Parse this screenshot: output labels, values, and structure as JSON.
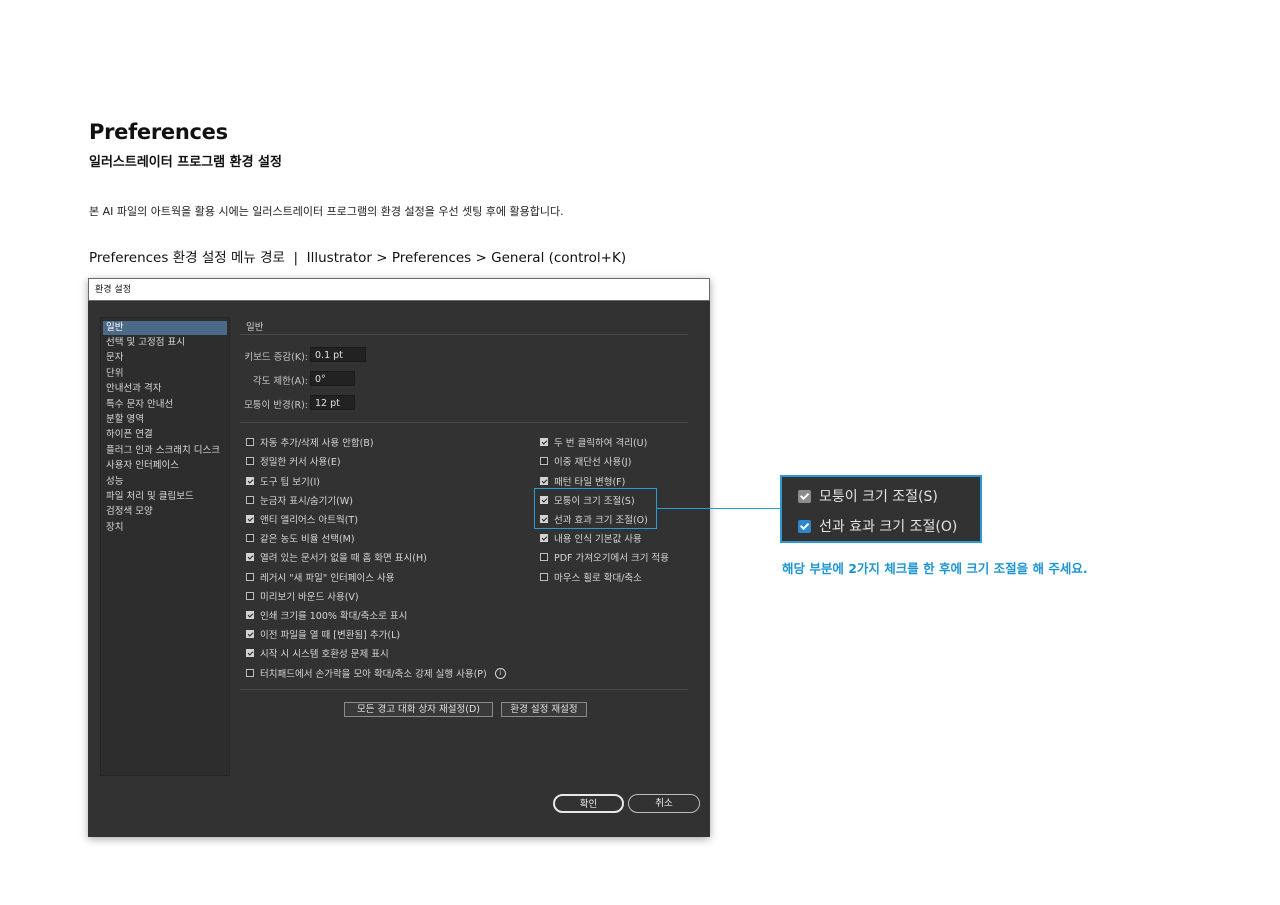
{
  "header": {
    "title": "Preferences",
    "subtitle": "일러스트레이터 프로그램 환경 설정",
    "description": "본 AI 파일의 아트웍을 활용 시에는 일러스트레이터 프로그램의 환경 설정을 우선 셋팅 후에 활용합니다.",
    "menu_path": "Preferences 환경 설정 메뉴 경로  |  Illustrator > Preferences > General (control+K)"
  },
  "dialog": {
    "title": "환경 설정",
    "sidebar": [
      {
        "label": "일반",
        "selected": true
      },
      {
        "label": "선택 및 고정점 표시"
      },
      {
        "label": "문자"
      },
      {
        "label": "단위"
      },
      {
        "label": "안내선과 격자"
      },
      {
        "label": "특수 문자 안내선"
      },
      {
        "label": "분할 영역"
      },
      {
        "label": "하이픈 연결"
      },
      {
        "label": "플러그 인과 스크래치 디스크"
      },
      {
        "label": "사용자 인터페이스"
      },
      {
        "label": "성능"
      },
      {
        "label": "파일 처리 및 클립보드"
      },
      {
        "label": "검정색 모양"
      },
      {
        "label": "장치"
      }
    ],
    "section_title": "일반",
    "fields": [
      {
        "label": "키보드 증감(K):",
        "value": "0.1 pt"
      },
      {
        "label": "각도 제한(A):",
        "value": "0°"
      },
      {
        "label": "모퉁이 반경(R):",
        "value": "12 pt"
      }
    ],
    "left_options": [
      {
        "label": "자동 추가/삭제 사용 안함(B)",
        "checked": false
      },
      {
        "label": "정밀한 커서 사용(E)",
        "checked": false
      },
      {
        "label": "도구 팁 보기(I)",
        "checked": true
      },
      {
        "label": "눈금자 표시/숨기기(W)",
        "checked": false
      },
      {
        "label": "앤티 앨리어스 아트웍(T)",
        "checked": true
      },
      {
        "label": "같은 농도 비율 선택(M)",
        "checked": false
      },
      {
        "label": "열려 있는 문서가 없을 때 홈 화면 표시(H)",
        "checked": true
      },
      {
        "label": "레거시 \"새 파일\" 인터페이스 사용",
        "checked": false
      },
      {
        "label": "미리보기 바운드 사용(V)",
        "checked": false
      },
      {
        "label": "인쇄 크기를 100% 확대/축소로 표시",
        "checked": true
      },
      {
        "label": "이전 파일을 열 때 [변환됨] 추가(L)",
        "checked": true
      },
      {
        "label": "시작 시 시스템 호환성 문제 표시",
        "checked": true
      },
      {
        "label": "터치패드에서 손가락을 모아 확대/축소 강제 실행 사용(P)",
        "checked": false
      }
    ],
    "right_options": [
      {
        "label": "두 번 클릭하여 격리(U)",
        "checked": true
      },
      {
        "label": "이중 재단선 사용(J)",
        "checked": false
      },
      {
        "label": "패턴 타일 변형(F)",
        "checked": true
      },
      {
        "label": "모퉁이 크기 조절(S)",
        "checked": true
      },
      {
        "label": "선과 효과 크기 조절(O)",
        "checked": true
      },
      {
        "label": "내용 인식 기본값 사용",
        "checked": true
      },
      {
        "label": "PDF 가져오기에서 크기 적용",
        "checked": false
      },
      {
        "label": "마우스 휠로 확대/축소",
        "checked": false
      }
    ],
    "info_icon": "info-icon",
    "reset_warnings_label": "모든 경고 대화 상자 재설정(D)",
    "reset_prefs_label": "환경 설정 재설정",
    "ok_label": "확인",
    "cancel_label": "취소"
  },
  "callout": {
    "options": [
      {
        "label": "모퉁이 크기 조절(S)",
        "checked": true
      },
      {
        "label": "선과 효과 크기 조절(O)",
        "checked": true
      }
    ],
    "note": "해당 부분에 2가지 체크를 한 후에 크기 조절을 해 주세요.",
    "accent_color": "#2b9bd6"
  }
}
